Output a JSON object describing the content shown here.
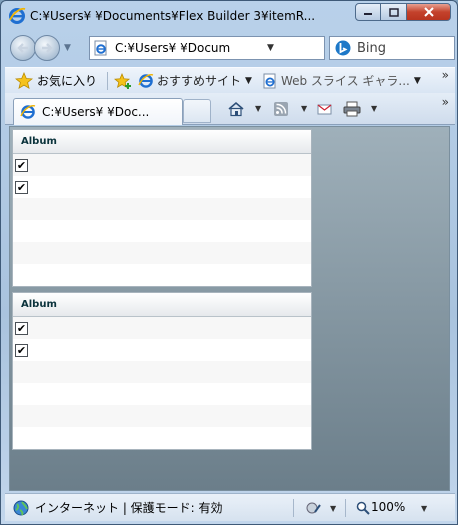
{
  "window": {
    "title": "C:¥Users¥          ¥Documents¥Flex Builder 3¥itemR..."
  },
  "navbar": {
    "address": "C:¥Users¥          ¥Docum",
    "search_placeholder": "Bing"
  },
  "favorites": {
    "favorites_label": "お気に入り",
    "suggested_sites_label": "おすすめサイト",
    "web_slice_label": "Web スライス ギャラ..."
  },
  "tabs": [
    {
      "label": "C:¥Users¥          ¥Doc..."
    }
  ],
  "grids": [
    {
      "header": "Album",
      "rows": [
        {
          "checked": true
        },
        {
          "checked": true
        },
        {
          "checked": false
        },
        {
          "checked": false
        },
        {
          "checked": false
        },
        {
          "checked": false
        }
      ]
    },
    {
      "header": "Album",
      "rows": [
        {
          "checked": true
        },
        {
          "checked": true
        },
        {
          "checked": false
        },
        {
          "checked": false
        },
        {
          "checked": false
        },
        {
          "checked": false
        }
      ]
    }
  ],
  "status": {
    "zone_text": "インターネット | 保護モード: 有効",
    "zoom": "100%"
  },
  "colors": {
    "close_button": "#c4422c",
    "content_bg_top": "#9fb0ba",
    "content_bg_bottom": "#6b7e8a",
    "grid_header_text": "#0b333c"
  },
  "icons": {
    "check_glyph": "✔"
  }
}
